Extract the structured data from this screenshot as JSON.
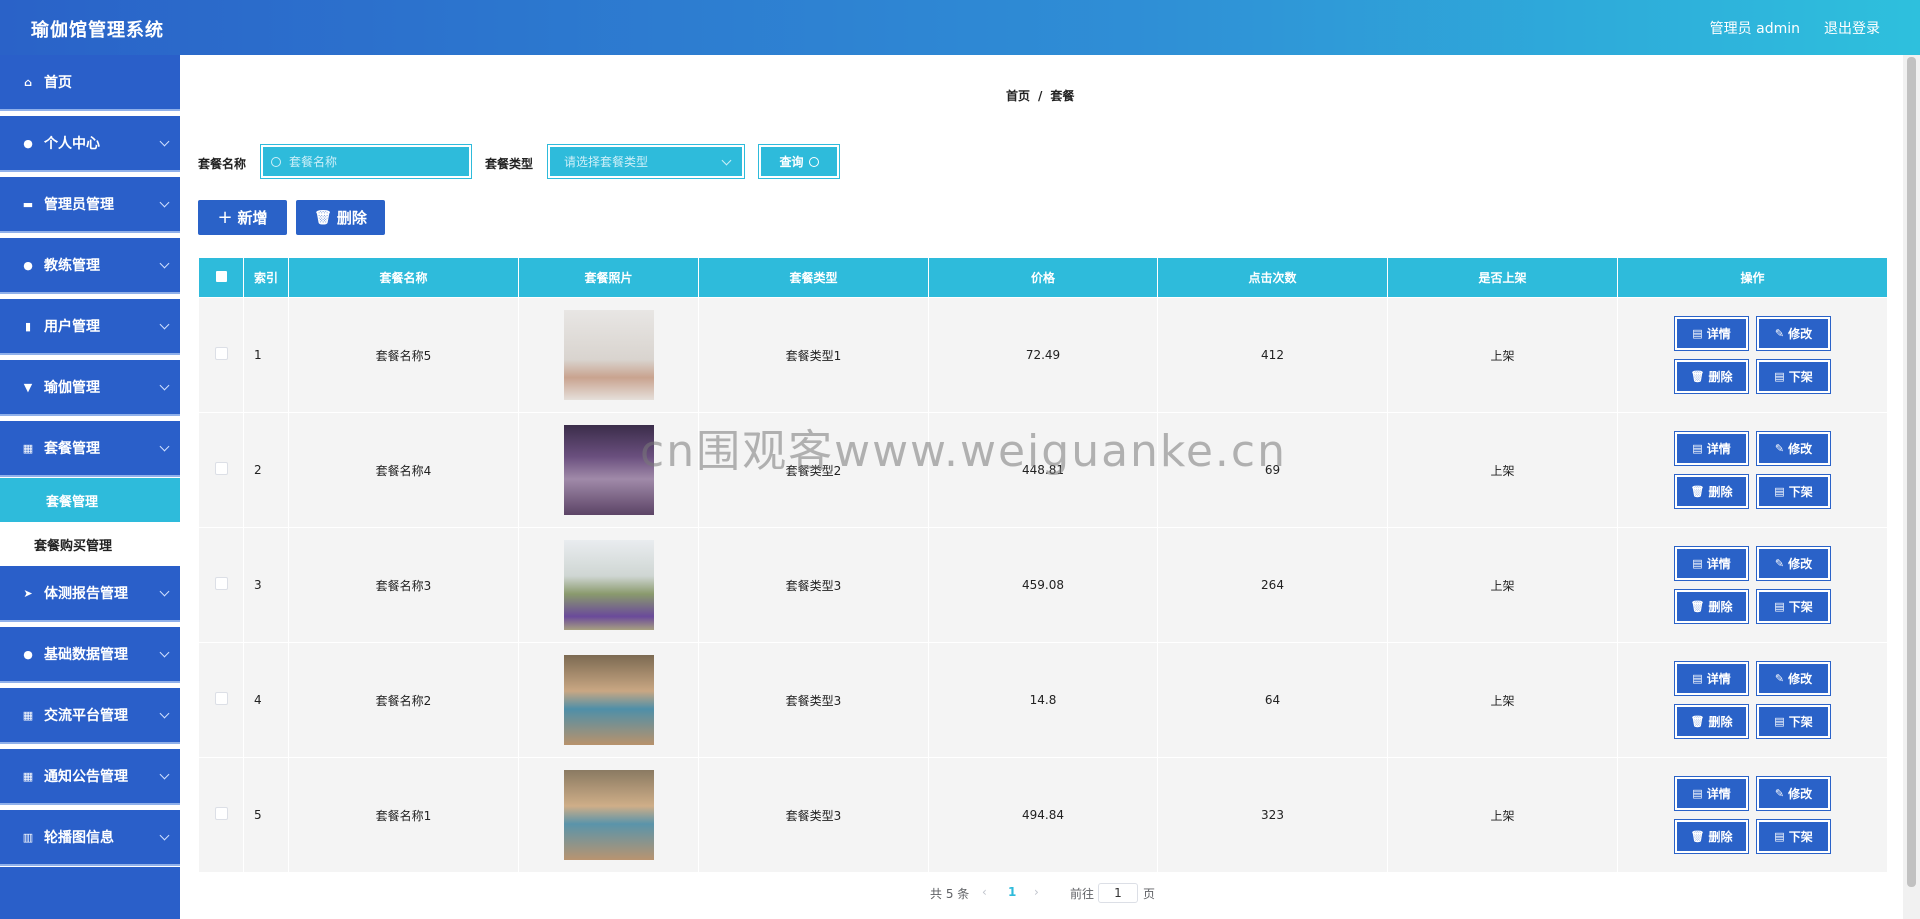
{
  "app": {
    "title": "瑜伽馆管理系统",
    "user": "管理员 admin",
    "logout": "退出登录"
  },
  "sidebar": {
    "items": [
      {
        "label": "首页",
        "icon": "home-icon"
      },
      {
        "label": "个人中心",
        "icon": "user-icon"
      },
      {
        "label": "管理员管理",
        "icon": "monitor-icon"
      },
      {
        "label": "教练管理",
        "icon": "user-icon"
      },
      {
        "label": "用户管理",
        "icon": "clipboard-icon"
      },
      {
        "label": "瑜伽管理",
        "icon": "flag-icon"
      },
      {
        "label": "套餐管理",
        "icon": "grid-icon"
      },
      {
        "label": "体测报告管理",
        "icon": "send-icon"
      },
      {
        "label": "基础数据管理",
        "icon": "pin-icon"
      },
      {
        "label": "交流平台管理",
        "icon": "grid-icon"
      },
      {
        "label": "通知公告管理",
        "icon": "grid-icon"
      },
      {
        "label": "轮播图信息",
        "icon": "chart-icon"
      }
    ],
    "sub_active": "套餐管理",
    "sub_item": "套餐购买管理"
  },
  "breadcrumb": {
    "home": "首页",
    "sep": "/",
    "current": "套餐"
  },
  "search": {
    "name_label": "套餐名称",
    "name_placeholder": "套餐名称",
    "type_label": "套餐类型",
    "type_placeholder": "请选择套餐类型",
    "query": "查询"
  },
  "actions": {
    "add": "新增",
    "delete": "删除"
  },
  "table": {
    "headers": [
      "索引",
      "套餐名称",
      "套餐照片",
      "套餐类型",
      "价格",
      "点击次数",
      "是否上架",
      "操作"
    ],
    "rows": [
      {
        "index": "1",
        "name": "套餐名称5",
        "type": "套餐类型1",
        "price": "72.49",
        "clicks": "412",
        "status": "上架"
      },
      {
        "index": "2",
        "name": "套餐名称4",
        "type": "套餐类型2",
        "price": "448.81",
        "clicks": "69",
        "status": "上架"
      },
      {
        "index": "3",
        "name": "套餐名称3",
        "type": "套餐类型3",
        "price": "459.08",
        "clicks": "264",
        "status": "上架"
      },
      {
        "index": "4",
        "name": "套餐名称2",
        "type": "套餐类型3",
        "price": "14.8",
        "clicks": "64",
        "status": "上架"
      },
      {
        "index": "5",
        "name": "套餐名称1",
        "type": "套餐类型3",
        "price": "494.84",
        "clicks": "323",
        "status": "上架"
      }
    ],
    "ops": {
      "detail": "详情",
      "edit": "修改",
      "delete": "删除",
      "offshelf": "下架"
    }
  },
  "pager": {
    "total": "共 5 条",
    "page": "1",
    "goto": "前往",
    "jump_value": "1",
    "unit": "页"
  },
  "watermark": "cn围观客www.weiguanke.cn",
  "colors": {
    "primary": "#2a62c8",
    "accent": "#2ebbdb"
  }
}
